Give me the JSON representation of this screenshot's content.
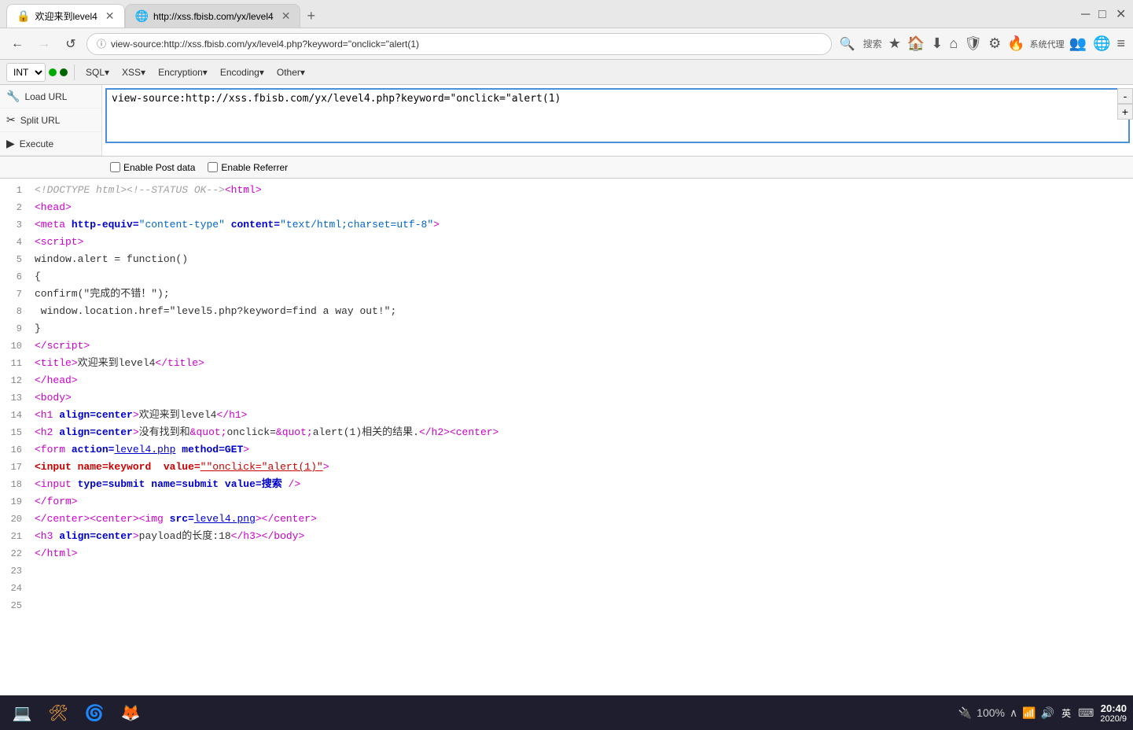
{
  "titlebar": {
    "tabs": [
      {
        "id": "tab1",
        "favicon": "🔒",
        "label": "欢迎来到level4",
        "active": true,
        "closable": true
      },
      {
        "id": "tab2",
        "favicon": "🌐",
        "label": "http://xss.fbisb.com/yx/level4",
        "active": false,
        "closable": true
      }
    ],
    "new_tab_label": "+",
    "controls": {
      "minimize": "─",
      "maximize": "□",
      "close": "✕"
    }
  },
  "navbar": {
    "back": "←",
    "forward": "→",
    "refresh": "↺",
    "home": "⌂",
    "url": "view-source:http://xss.fbisb.com/yx/level4.php?keyword=\"onclick=\"alert(1)",
    "lock_icon": "ⓘ",
    "search_placeholder": "搜索",
    "nav_icons": [
      "★",
      "🏠",
      "⬇",
      "⌂",
      "🛡",
      "⚙",
      "🔥",
      "系统代理",
      "👥",
      "🌐",
      "≡"
    ]
  },
  "toolbar": {
    "select_value": "INT",
    "items": [
      {
        "type": "dot",
        "color": "green"
      },
      {
        "type": "dot",
        "color": "darkgreen"
      },
      {
        "type": "button",
        "label": "SQL▾"
      },
      {
        "type": "button",
        "label": "XSS▾"
      },
      {
        "type": "button",
        "label": "Encryption▾"
      },
      {
        "type": "button",
        "label": "Encoding▾"
      },
      {
        "type": "button",
        "label": "Other▾"
      }
    ]
  },
  "sidebar": {
    "load_url_label": "Load URL",
    "split_url_label": "Split URL",
    "execute_label": "Execute"
  },
  "url_input": {
    "value": "view-source:http://xss.fbisb.com/yx/level4.php?keyword=\"onclick=\"alert(1)",
    "plus": "+",
    "minus": "-"
  },
  "checkboxes": {
    "post_data_label": "Enable Post data",
    "referrer_label": "Enable Referrer"
  },
  "source_lines": [
    {
      "num": 1,
      "html": "<span class='c-comment'>&lt;!DOCTYPE html&gt;&lt;!--STATUS OK--&gt;</span><span class='c-tag'>&lt;html&gt;</span>"
    },
    {
      "num": 2,
      "html": "<span class='c-tag'>&lt;head&gt;</span>"
    },
    {
      "num": 3,
      "html": "<span class='c-tag'>&lt;meta</span> <span class='c-attr'>http-equiv=</span><span class='c-string'>\"content-type\"</span> <span class='c-attr'>content=</span><span class='c-string'>\"text/html;charset=utf-8\"</span><span class='c-tag'>&gt;</span>"
    },
    {
      "num": 4,
      "html": "<span class='c-tag'>&lt;script&gt;</span>"
    },
    {
      "num": 5,
      "html": "<span class='c-js'>window.alert = function()</span>"
    },
    {
      "num": 6,
      "html": "<span class='c-js'>{</span>"
    },
    {
      "num": 7,
      "html": "<span class='c-js'>confirm(&quot;完成的不错！&quot;);</span>"
    },
    {
      "num": 8,
      "html": "<span class='c-js'>&nbsp;window.location.href=&quot;level5.php?keyword=find a way out!&quot;;</span>"
    },
    {
      "num": 9,
      "html": "<span class='c-js'>}</span>"
    },
    {
      "num": 10,
      "html": "<span class='c-tag'>&lt;/script&gt;</span>"
    },
    {
      "num": 11,
      "html": "<span class='c-tag'>&lt;title&gt;</span><span class='c-text'>欢迎来到level4</span><span class='c-tag'>&lt;/title&gt;</span>"
    },
    {
      "num": 12,
      "html": "<span class='c-tag'>&lt;/head&gt;</span>"
    },
    {
      "num": 13,
      "html": "<span class='c-tag'>&lt;body&gt;</span>"
    },
    {
      "num": 14,
      "html": "<span class='c-tag'>&lt;h1</span> <span class='c-attr'>align=center</span><span class='c-tag'>&gt;</span><span class='c-text'>欢迎来到level4</span><span class='c-tag'>&lt;/h1&gt;</span>"
    },
    {
      "num": 15,
      "html": "<span class='c-tag'>&lt;h2</span> <span class='c-attr'>align=center</span><span class='c-tag'>&gt;</span><span class='c-text'>没有找到和</span><span class='c-tag'>&amp;quot;</span><span class='c-text'>onclick=</span><span class='c-tag'>&amp;quot;</span><span class='c-text'>alert(1)相关的结果.</span><span class='c-tag'>&lt;/h2&gt;&lt;center&gt;</span>"
    },
    {
      "num": 16,
      "html": "<span class='c-tag'>&lt;form</span> <span class='c-attr'>action=</span><span class='c-link'>level4.php</span> <span class='c-attr'>method=GET</span><span class='c-tag'>&gt;</span>"
    },
    {
      "num": 17,
      "html": "<span class='c-attr-red'>&lt;input</span> <span class='c-attr-red'>name=keyword</span>  <span class='c-attr-red'>value=</span><span class='c-red-underline'>&quot;&quot;onclick=&quot;alert(1)&quot;</span><span class='c-tag'>&gt;</span>"
    },
    {
      "num": 18,
      "html": "<span class='c-tag'>&lt;input</span> <span class='c-attr'>type=submit</span> <span class='c-attr'>name=submit</span> <span class='c-attr'>value=搜索</span> <span class='c-tag'>/&gt;</span>"
    },
    {
      "num": 19,
      "html": "<span class='c-tag'>&lt;/form&gt;</span>"
    },
    {
      "num": 20,
      "html": "<span class='c-tag'>&lt;/center&gt;&lt;center&gt;&lt;img</span> <span class='c-attr'>src=</span><span class='c-link'>level4.png</span><span class='c-tag'>&gt;&lt;/center&gt;</span>"
    },
    {
      "num": 21,
      "html": "<span class='c-tag'>&lt;h3</span> <span class='c-attr'>align=center</span><span class='c-tag'>&gt;</span><span class='c-text'>payload的长度:18</span><span class='c-tag'>&lt;/h3&gt;&lt;/body&gt;</span>"
    },
    {
      "num": 22,
      "html": "<span class='c-tag'>&lt;/html&gt;</span>"
    },
    {
      "num": 23,
      "html": ""
    },
    {
      "num": 24,
      "html": ""
    },
    {
      "num": 25,
      "html": ""
    }
  ],
  "taskbar": {
    "apps": [
      {
        "id": "pc",
        "icon": "💻",
        "label": "PC"
      },
      {
        "id": "dev",
        "icon": "🛠",
        "label": "DEV"
      },
      {
        "id": "ie",
        "icon": "🌀",
        "label": "IE"
      },
      {
        "id": "firefox",
        "icon": "🦊",
        "label": "Firefox"
      }
    ],
    "system": {
      "battery": "🔌",
      "battery_pct": "100%",
      "expand": "∧",
      "network": "📶",
      "volume": "🔊",
      "lang": "英",
      "keyboard": "⌨",
      "time": "20:40",
      "date": "2020/9"
    }
  }
}
